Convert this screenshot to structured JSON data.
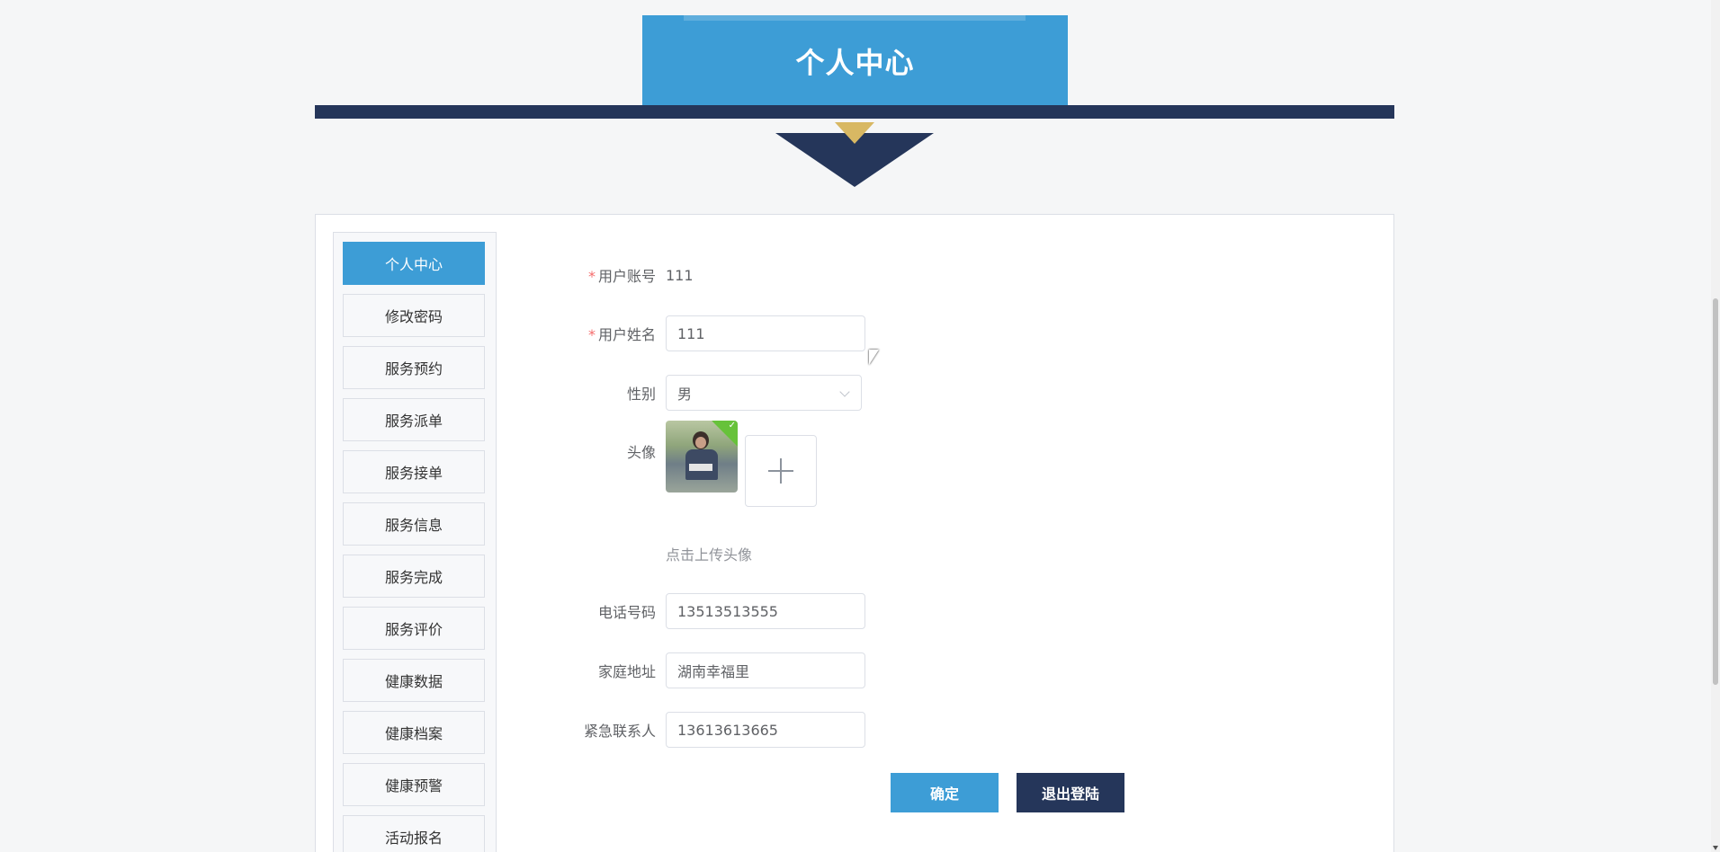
{
  "header": {
    "title": "个人中心"
  },
  "sidebar": {
    "items": [
      {
        "label": "个人中心",
        "active": true
      },
      {
        "label": "修改密码"
      },
      {
        "label": "服务预约"
      },
      {
        "label": "服务派单"
      },
      {
        "label": "服务接单"
      },
      {
        "label": "服务信息"
      },
      {
        "label": "服务完成"
      },
      {
        "label": "服务评价"
      },
      {
        "label": "健康数据"
      },
      {
        "label": "健康档案"
      },
      {
        "label": "健康预警"
      },
      {
        "label": "活动报名"
      }
    ]
  },
  "form": {
    "account": {
      "label": "用户账号",
      "required": "*",
      "value": "111"
    },
    "name": {
      "label": "用户姓名",
      "required": "*",
      "value": "111"
    },
    "gender": {
      "label": "性别",
      "value": "男"
    },
    "avatar": {
      "label": "头像",
      "hint": "点击上传头像"
    },
    "phone": {
      "label": "电话号码",
      "value": "13513513555"
    },
    "address": {
      "label": "家庭地址",
      "value": "湖南幸福里"
    },
    "emergency": {
      "label": "紧急联系人",
      "value": "13613613665"
    }
  },
  "actions": {
    "confirm": "确定",
    "logout": "退出登陆"
  },
  "colors": {
    "primary": "#3d9dd6",
    "navy": "#25365a",
    "gold": "#d8b863",
    "required": "#f56c6c"
  }
}
